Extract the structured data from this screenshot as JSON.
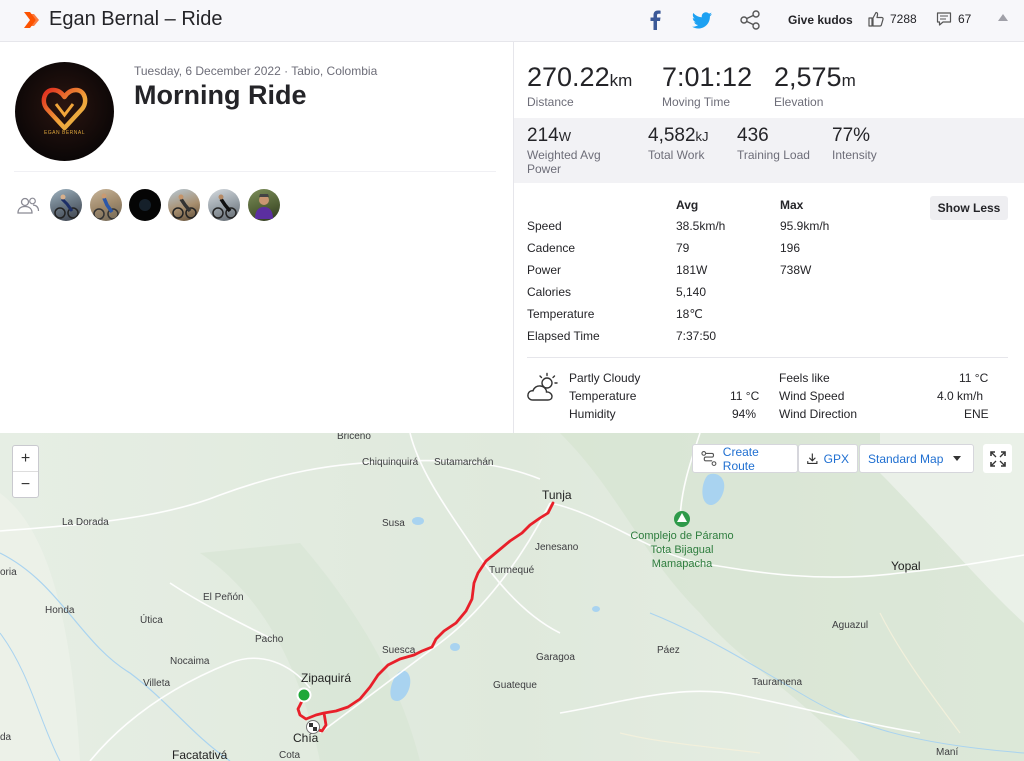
{
  "header": {
    "title": "Egan Bernal – Ride",
    "give_kudos": "Give kudos",
    "kudos_count": "7288",
    "comment_count": "67"
  },
  "activity": {
    "date_location": "Tuesday, 6 December 2022 · Tabio, Colombia",
    "name": "Morning Ride",
    "avatar_brand": "EGAN BERNAL"
  },
  "stats_primary": [
    {
      "value": "270.22",
      "unit": "km",
      "label": "Distance"
    },
    {
      "value": "7:01:12",
      "unit": "",
      "label": "Moving Time"
    },
    {
      "value": "2,575",
      "unit": "m",
      "label": "Elevation"
    }
  ],
  "stats_secondary": [
    {
      "value": "214",
      "unit": "W",
      "label": "Weighted Avg Power"
    },
    {
      "value": "4,582",
      "unit": "kJ",
      "label": "Total Work"
    },
    {
      "value": "436",
      "unit": "",
      "label": "Training Load"
    },
    {
      "value": "77%",
      "unit": "",
      "label": "Intensity"
    }
  ],
  "detail_table": {
    "col_avg": "Avg",
    "col_max": "Max",
    "show_less": "Show Less",
    "rows": [
      {
        "label": "Speed",
        "avg": "38.5km/h",
        "max": "95.9km/h"
      },
      {
        "label": "Cadence",
        "avg": "79",
        "max": "196"
      },
      {
        "label": "Power",
        "avg": "181W",
        "max": "738W"
      },
      {
        "label": "Calories",
        "avg": "5,140",
        "max": ""
      },
      {
        "label": "Temperature",
        "avg": "18℃",
        "max": ""
      },
      {
        "label": "Elapsed Time",
        "avg": "7:37:50",
        "max": ""
      }
    ]
  },
  "weather": {
    "condition": "Partly Cloudy",
    "temperature_label": "Temperature",
    "temperature": "11 °C",
    "humidity_label": "Humidity",
    "humidity": "94%",
    "feels_like_label": "Feels like",
    "feels_like": "11 °C",
    "wind_speed_label": "Wind Speed",
    "wind_speed": "4.0 km/h",
    "wind_direction_label": "Wind Direction",
    "wind_direction": "ENE"
  },
  "map": {
    "zoom_in": "+",
    "zoom_out": "−",
    "create_route": "Create Route",
    "gpx": "GPX",
    "map_type": "Standard Map",
    "places": {
      "briceno": "Briceño",
      "chiquinquira": "Chiquinquirá",
      "sutamarchan": "Sutamarchán",
      "tunja": "Tunja",
      "la_dorada": "La Dorada",
      "susa": "Susa",
      "jenesano": "Jenesano",
      "turmeque": "Turmequé",
      "yopal": "Yopal",
      "oria": "oria",
      "honda": "Honda",
      "el_penon": "El Peñón",
      "utica": "Útica",
      "pacho": "Pacho",
      "aguazul": "Aguazul",
      "suesca": "Suesca",
      "garagoa": "Garagoa",
      "paez": "Páez",
      "nocaima": "Nocaima",
      "zipaquira": "Zipaquirá",
      "villeta": "Villeta",
      "guateque": "Guateque",
      "tauramena": "Tauramena",
      "chia": "Chía",
      "facatativa": "Facatativá",
      "cota": "Cota",
      "mani": "Maní",
      "da": "da"
    },
    "park_name": "Complejo de Páramo Tota Bijagual Mamapacha",
    "colors": {
      "route": "#e8202a",
      "start": "#1ea838",
      "water": "#a9d3f0",
      "land": "#e3ece1"
    }
  },
  "colors": {
    "brand": "#fc5200",
    "link": "#1f6fd1",
    "facebook": "#3b5998",
    "twitter": "#1da1f2"
  }
}
